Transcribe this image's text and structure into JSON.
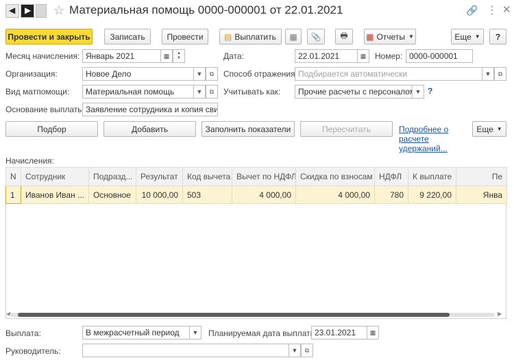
{
  "header": {
    "title": "Материальная помощь 0000-000001 от 22.01.2021"
  },
  "toolbar": {
    "post_close": "Провести и закрыть",
    "save": "Записать",
    "post": "Провести",
    "pay": "Выплатить",
    "reports": "Отчеты",
    "more": "Еще",
    "help": "?"
  },
  "form": {
    "month_label": "Месяц начисления:",
    "month_value": "Январь 2021",
    "date_label": "Дата:",
    "date_value": "22.01.2021",
    "number_label": "Номер:",
    "number_value": "0000-000001",
    "org_label": "Организация:",
    "org_value": "Новое Дело",
    "reflection_label": "Способ отражения:",
    "reflection_placeholder": "Подбирается автоматически",
    "aid_type_label": "Вид матпомощи:",
    "aid_type_value": "Материальная помощь",
    "account_as_label": "Учитывать как:",
    "account_as_value": "Прочие расчеты с персоналом",
    "basis_label": "Основание выплаты:",
    "basis_value": "Заявление сотрудника и копия свидет"
  },
  "actions": {
    "select": "Подбор",
    "add": "Добавить",
    "fill": "Заполнить показатели",
    "recalc": "Пересчитать",
    "details_link": "Подробнее о расчете удержаний...",
    "more": "Еще"
  },
  "accruals": {
    "label": "Начисления:",
    "columns": [
      "N",
      "Сотрудник",
      "Подразд...",
      "Результат",
      "Код вычета",
      "Вычет по НДФЛ",
      "Скидка по взносам",
      "НДФЛ",
      "К выплате",
      "Пе"
    ],
    "rows": [
      [
        "1",
        "Иванов Иван ...",
        "Основное",
        "10 000,00",
        "503",
        "4 000,00",
        "4 000,00",
        "780",
        "9 220,00",
        "Янва"
      ]
    ]
  },
  "footer": {
    "payment_label": "Выплата:",
    "payment_value": "В межрасчетный период",
    "planned_date_label": "Планируемая дата выплаты:",
    "planned_date_value": "23.01.2021",
    "manager_label": "Руководитель:",
    "manager_value": ""
  }
}
